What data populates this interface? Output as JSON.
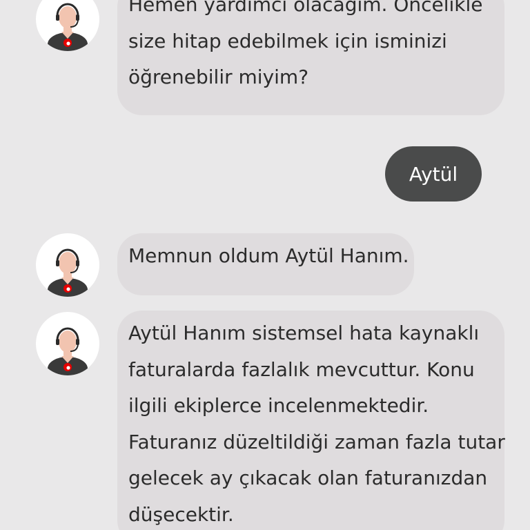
{
  "messages": [
    {
      "sender": "agent",
      "lines": [
        "Hemen yardımcı olacağım. Öncelikle",
        "size hitap edebilmek için isminizi",
        "öğrenebilir miyim?"
      ]
    },
    {
      "sender": "user",
      "text": "Aytül"
    },
    {
      "sender": "agent",
      "lines": [
        "Memnun oldum Aytül Hanım."
      ]
    },
    {
      "sender": "agent",
      "lines": [
        "Aytül Hanım sistemsel hata kaynaklı",
        "faturalarda fazlalık mevcuttur. Konu",
        "ilgili ekiplerce incelenmektedir.",
        "Faturanız düzeltildiği zaman fazla tutar",
        "gelecek ay çıkacak olan faturanızdan",
        "düşecektir."
      ]
    }
  ],
  "avatar_icon": "support-agent-headset-icon",
  "colors": {
    "background": "#e9e8e9",
    "agent_bubble": "#dfdcde",
    "user_bubble": "#4a4b4b",
    "brand_red": "#e60000"
  }
}
